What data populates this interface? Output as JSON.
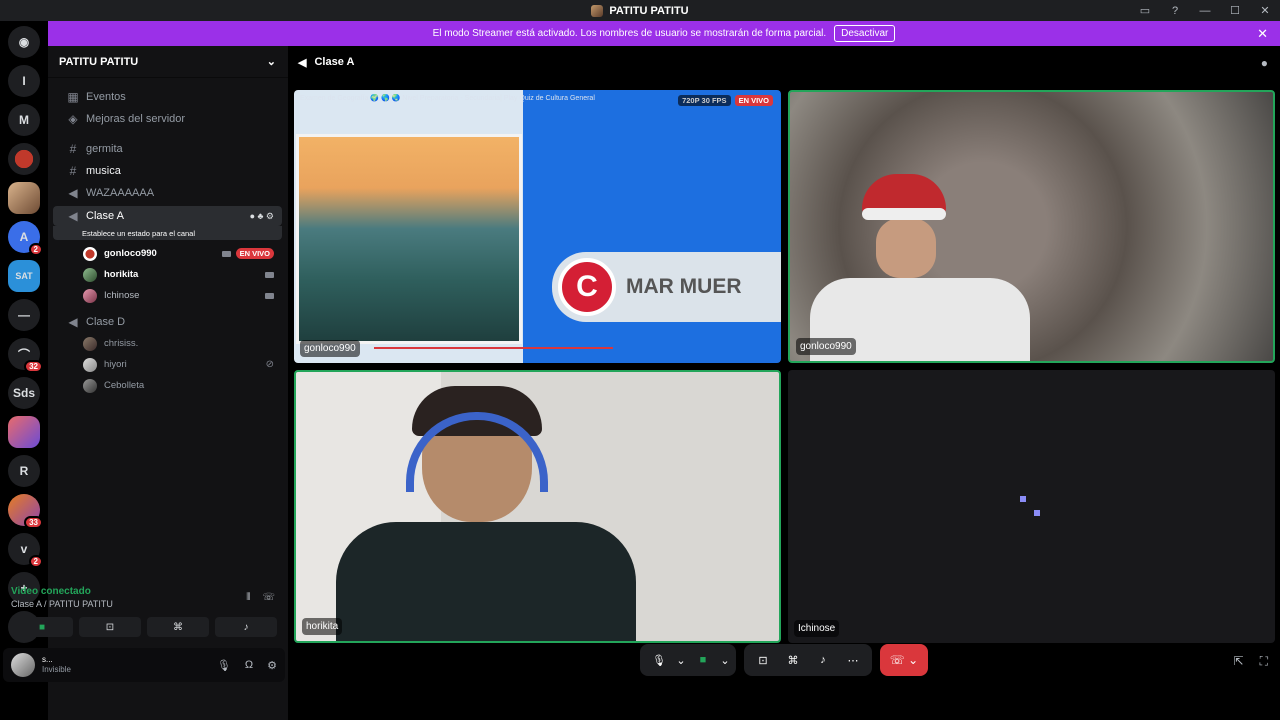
{
  "window": {
    "title": "PATITU PATITU",
    "controls": [
      "—",
      "☐",
      "✕"
    ]
  },
  "banner": {
    "text": "El modo Streamer está activado. Los nombres de usuario se mostrarán de forma parcial.",
    "button": "Desactivar"
  },
  "rail": {
    "items": [
      "I",
      "M",
      "",
      "",
      "",
      "SAT",
      "",
      "",
      "Sds",
      "",
      "R",
      "",
      "",
      ""
    ],
    "badges": {
      "a": "2",
      "b": "32",
      "c": "33",
      "d": "2"
    }
  },
  "server": {
    "name": "PATITU PATITU"
  },
  "sidebar": {
    "events": "Eventos",
    "boosts": "Mejoras del servidor",
    "channels": [
      "germita",
      "musica",
      "WAZAAAAAA",
      "Clase A",
      "Clase D"
    ],
    "clase_a_status": "Establece un estado para el canal",
    "clase_a_users": [
      {
        "name": "gonloco990",
        "badge": "EN VIVO"
      },
      {
        "name": "horikita"
      },
      {
        "name": "Ichinose"
      }
    ],
    "clase_d_users": [
      {
        "name": "chrisiss."
      },
      {
        "name": "hiyori"
      },
      {
        "name": "Cebolleta"
      }
    ]
  },
  "voice": {
    "status": "Video conectado",
    "channel": "Clase A / PATITU PATITU"
  },
  "user": {
    "name": "s...",
    "status": "Invisible"
  },
  "main": {
    "channel": "Clase A"
  },
  "tiles": {
    "stream": {
      "caption": "Examen de Geografía 🌍 🌎 🌏 Nivel Preparatoria - Secundaria| Play Quiz de Cultura General",
      "quality": "720P 30 FPS",
      "live": "EN VIVO",
      "logo_letter": "C",
      "logo_text": "MAR MUER",
      "name": "gonloco990"
    },
    "cam1": {
      "name": "gonloco990"
    },
    "cam2": {
      "name": "horikita"
    },
    "empty": {
      "name": "Ichinose"
    }
  },
  "colors": {
    "accent": "#9b30e8",
    "live": "#da373c",
    "connected": "#23a55a"
  }
}
